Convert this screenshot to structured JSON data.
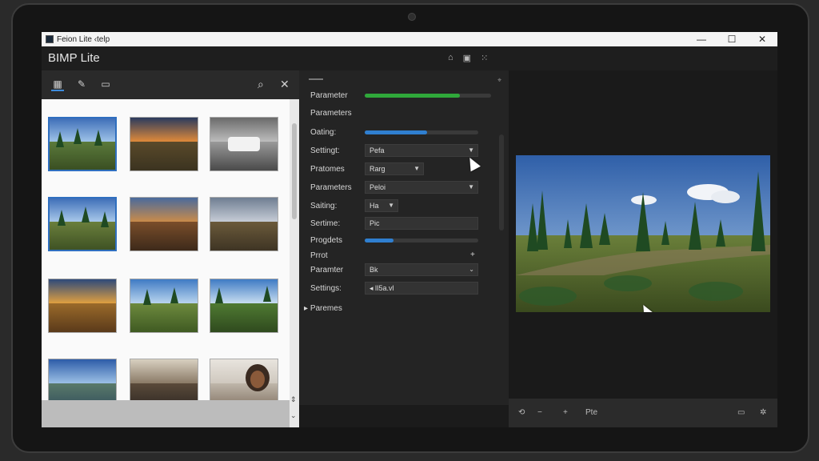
{
  "window": {
    "title": "Feion Lite ‹telp",
    "minimize": "—",
    "maximize": "☐",
    "close": "✕"
  },
  "app": {
    "name": "BIMP Lite",
    "header_icons": [
      "home-icon",
      "image-icon",
      "grid-icon"
    ]
  },
  "left_panel": {
    "tabs": [
      "batch-icon",
      "brush-icon",
      "folder-icon"
    ],
    "tools": [
      "search-icon",
      "close-icon"
    ],
    "thumbnails": [
      {
        "name": "pine-forest",
        "selected": true
      },
      {
        "name": "sunset-road",
        "selected": false
      },
      {
        "name": "car-bw",
        "selected": false
      },
      {
        "name": "pine-forest-2",
        "selected": true
      },
      {
        "name": "autumn-road",
        "selected": false
      },
      {
        "name": "field-rows",
        "selected": false
      },
      {
        "name": "sunset-field",
        "selected": false
      },
      {
        "name": "pine-meadow",
        "selected": false
      },
      {
        "name": "forest-path",
        "selected": false
      },
      {
        "name": "river-sky",
        "selected": false
      },
      {
        "name": "interior-hall",
        "selected": false
      },
      {
        "name": "woman-portrait",
        "selected": false
      }
    ]
  },
  "settings": {
    "row1_label": "Parameter",
    "row1_progress": 0.75,
    "section_label": "Parameters",
    "row2_label": "Oating:",
    "row2_progress": 0.55,
    "row3_label": "Settingt:",
    "row3_value": "Pefa",
    "row4_label": "Pratomes",
    "row4_value": "Rarg",
    "row5_label": "Parameters",
    "row5_value": "Peloi",
    "row6_label": "Saiting:",
    "row6_value": "Ha",
    "row7_label": "Sertime:",
    "row7_value": "Pic",
    "row8_label": "Progdets",
    "row8_progress": 0.25,
    "row9_label": "Prrot",
    "row9_action": "+",
    "row10_label": "Paramter",
    "row10_value": "Bk",
    "row11_label": "Settings:",
    "row11_value": "lI5a.vl",
    "collapsed_label": "Paremes"
  },
  "preview_bar": {
    "zoom": "Pte"
  },
  "colors": {
    "accent_blue": "#2f6fbf",
    "progress_green": "#2fa83a",
    "progress_blue": "#2f7fd0"
  }
}
